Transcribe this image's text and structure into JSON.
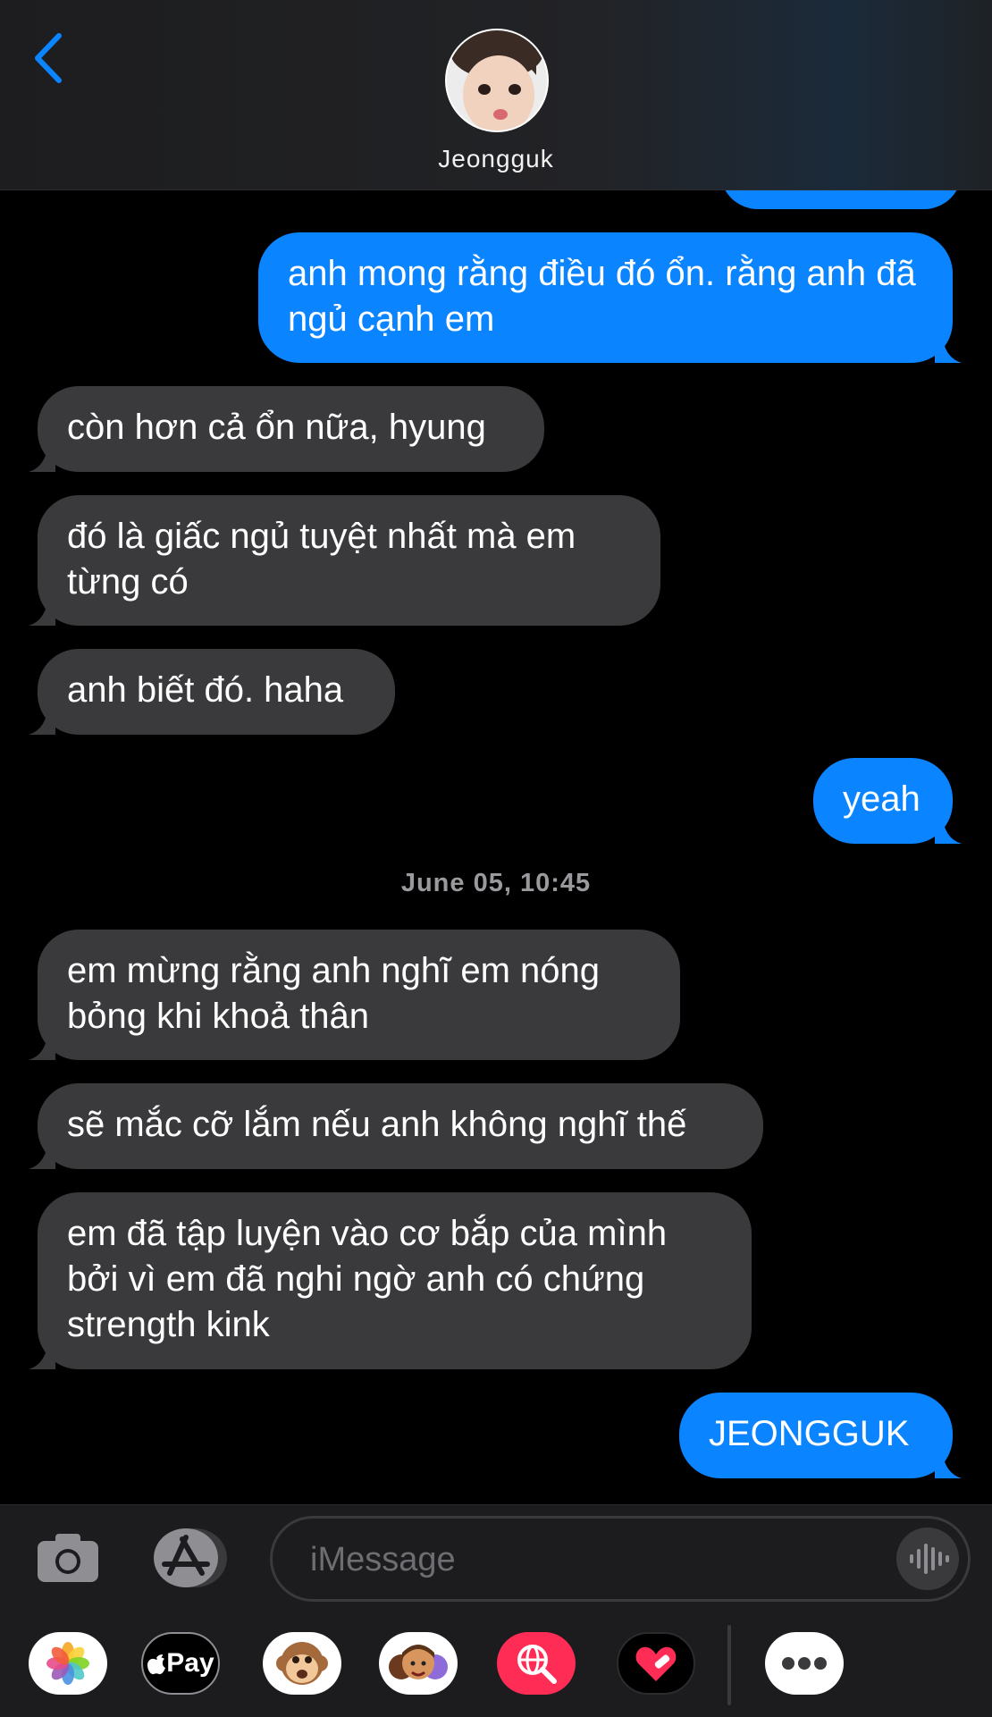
{
  "header": {
    "contact_name": "Jeongguk"
  },
  "messages": [
    {
      "dir": "out",
      "text": "anh mong rằng điều đó ổn. rằng anh đã ngủ cạnh em"
    },
    {
      "dir": "in",
      "text": "còn hơn cả ổn nữa, hyung"
    },
    {
      "dir": "in",
      "text": "đó là giấc ngủ tuyệt nhất mà em từng có"
    },
    {
      "dir": "in",
      "text": "anh biết đó. haha"
    },
    {
      "dir": "out",
      "text": "yeah"
    },
    {
      "dir": "in",
      "text": "em mừng rằng anh nghĩ em nóng bỏng khi khoả thân"
    },
    {
      "dir": "in",
      "text": "sẽ mắc cỡ lắm nếu anh không nghĩ thế"
    },
    {
      "dir": "in",
      "text": "em đã tập luyện vào cơ bắp của mình bởi vì em đã nghi ngờ anh có chứng strength kink"
    },
    {
      "dir": "out",
      "text": "JEONGGUK"
    }
  ],
  "timestamp": "June 05, 10:45",
  "composer": {
    "placeholder": "iMessage"
  },
  "app_drawer": {
    "apple_pay_label": "Pay",
    "items": [
      "photos-icon",
      "apple-pay-icon",
      "animoji-icon",
      "memoji-icon",
      "web-search-icon",
      "digital-touch-icon",
      "more-icon"
    ]
  },
  "colors": {
    "outgoing": "#0a84ff",
    "incoming": "#3a3a3c",
    "accent": "#0a84ff"
  }
}
